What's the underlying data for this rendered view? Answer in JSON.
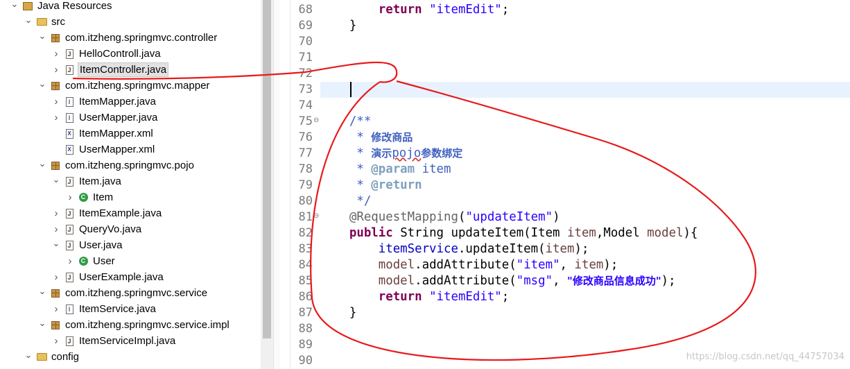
{
  "explorer": {
    "items": [
      {
        "label": "Java Resources",
        "twisty": "expanded",
        "icon": "library-folder-icon"
      },
      {
        "label": "src",
        "twisty": "expanded",
        "icon": "source-folder-icon"
      },
      {
        "label": "com.itzheng.springmvc.controller",
        "twisty": "expanded",
        "icon": "package-icon"
      },
      {
        "label": "HelloControll.java",
        "twisty": "collapsed",
        "icon": "java-file-icon"
      },
      {
        "label": "ItemController.java",
        "twisty": "collapsed",
        "icon": "java-file-icon",
        "selected": true
      },
      {
        "label": "com.itzheng.springmvc.mapper",
        "twisty": "expanded",
        "icon": "package-icon"
      },
      {
        "label": "ItemMapper.java",
        "twisty": "collapsed",
        "icon": "java-interface-icon"
      },
      {
        "label": "UserMapper.java",
        "twisty": "collapsed",
        "icon": "java-interface-icon"
      },
      {
        "label": "ItemMapper.xml",
        "twisty": "none",
        "icon": "xml-file-icon"
      },
      {
        "label": "UserMapper.xml",
        "twisty": "none",
        "icon": "xml-file-icon"
      },
      {
        "label": "com.itzheng.springmvc.pojo",
        "twisty": "expanded",
        "icon": "package-icon"
      },
      {
        "label": "Item.java",
        "twisty": "expanded",
        "icon": "java-file-icon"
      },
      {
        "label": "Item",
        "twisty": "collapsed",
        "icon": "class-icon"
      },
      {
        "label": "ItemExample.java",
        "twisty": "collapsed",
        "icon": "java-file-icon"
      },
      {
        "label": "QueryVo.java",
        "twisty": "collapsed",
        "icon": "java-file-icon"
      },
      {
        "label": "User.java",
        "twisty": "expanded",
        "icon": "java-file-icon"
      },
      {
        "label": "User",
        "twisty": "collapsed",
        "icon": "class-icon"
      },
      {
        "label": "UserExample.java",
        "twisty": "collapsed",
        "icon": "java-file-icon"
      },
      {
        "label": "com.itzheng.springmvc.service",
        "twisty": "expanded",
        "icon": "package-icon"
      },
      {
        "label": "ItemService.java",
        "twisty": "collapsed",
        "icon": "java-interface-icon"
      },
      {
        "label": "com.itzheng.springmvc.service.impl",
        "twisty": "expanded",
        "icon": "package-icon"
      },
      {
        "label": "ItemServiceImpl.java",
        "twisty": "collapsed",
        "icon": "java-file-icon"
      },
      {
        "label": "config",
        "twisty": "expanded",
        "icon": "source-folder-icon"
      }
    ]
  },
  "editor": {
    "current_line": 73,
    "lines": [
      {
        "n": "68",
        "tokens": [
          {
            "t": "        "
          },
          {
            "t": "return",
            "c": "kw"
          },
          {
            "t": " "
          },
          {
            "t": "\"itemEdit\"",
            "c": "str"
          },
          {
            "t": ";"
          }
        ]
      },
      {
        "n": "69",
        "tokens": [
          {
            "t": "    }"
          }
        ]
      },
      {
        "n": "70",
        "tokens": []
      },
      {
        "n": "71",
        "tokens": []
      },
      {
        "n": "72",
        "tokens": []
      },
      {
        "n": "73",
        "tokens": []
      },
      {
        "n": "74",
        "tokens": []
      },
      {
        "n": "75",
        "fold": "⊖",
        "tokens": [
          {
            "t": "    /**",
            "c": "cmt"
          }
        ]
      },
      {
        "n": "76",
        "tokens": [
          {
            "t": "     * ",
            "c": "cmt"
          },
          {
            "t": "修改商品",
            "c": "cmt cjk"
          }
        ]
      },
      {
        "n": "77",
        "tokens": [
          {
            "t": "     * ",
            "c": "cmt"
          },
          {
            "t": "演示",
            "c": "cmt cjk"
          },
          {
            "t": "pojo",
            "c": "cmt err"
          },
          {
            "t": "参数绑定",
            "c": "cmt cjk"
          }
        ]
      },
      {
        "n": "78",
        "tokens": [
          {
            "t": "     * ",
            "c": "cmt"
          },
          {
            "t": "@param",
            "c": "tag"
          },
          {
            "t": " item",
            "c": "cmt"
          }
        ]
      },
      {
        "n": "79",
        "tokens": [
          {
            "t": "     * ",
            "c": "cmt"
          },
          {
            "t": "@return",
            "c": "tag"
          }
        ]
      },
      {
        "n": "80",
        "tokens": [
          {
            "t": "     */",
            "c": "cmt"
          }
        ]
      },
      {
        "n": "81",
        "fold": "⊖",
        "tokens": [
          {
            "t": "    "
          },
          {
            "t": "@RequestMapping",
            "c": "ann"
          },
          {
            "t": "("
          },
          {
            "t": "\"updateItem\"",
            "c": "str"
          },
          {
            "t": ")"
          }
        ]
      },
      {
        "n": "82",
        "tokens": [
          {
            "t": "    "
          },
          {
            "t": "public",
            "c": "kw"
          },
          {
            "t": " String updateItem(Item "
          },
          {
            "t": "item",
            "c": "var"
          },
          {
            "t": ",Model "
          },
          {
            "t": "model",
            "c": "var"
          },
          {
            "t": "){"
          }
        ]
      },
      {
        "n": "83",
        "tokens": [
          {
            "t": "        "
          },
          {
            "t": "itemService",
            "c": "fld"
          },
          {
            "t": ".updateItem("
          },
          {
            "t": "item",
            "c": "var"
          },
          {
            "t": ");"
          }
        ]
      },
      {
        "n": "84",
        "tokens": [
          {
            "t": "        "
          },
          {
            "t": "model",
            "c": "var"
          },
          {
            "t": ".addAttribute("
          },
          {
            "t": "\"item\"",
            "c": "str"
          },
          {
            "t": ", "
          },
          {
            "t": "item",
            "c": "var"
          },
          {
            "t": ");"
          }
        ]
      },
      {
        "n": "85",
        "tokens": [
          {
            "t": "        "
          },
          {
            "t": "model",
            "c": "var"
          },
          {
            "t": ".addAttribute("
          },
          {
            "t": "\"msg\"",
            "c": "str"
          },
          {
            "t": ", "
          },
          {
            "t": "\"修改商品信息成功\"",
            "c": "str cjk"
          },
          {
            "t": ");"
          }
        ]
      },
      {
        "n": "86",
        "tokens": [
          {
            "t": "        "
          },
          {
            "t": "return",
            "c": "kw"
          },
          {
            "t": " "
          },
          {
            "t": "\"itemEdit\"",
            "c": "str"
          },
          {
            "t": ";"
          }
        ]
      },
      {
        "n": "87",
        "tokens": [
          {
            "t": "    }"
          }
        ]
      },
      {
        "n": "88",
        "tokens": []
      },
      {
        "n": "89",
        "tokens": []
      },
      {
        "n": "90",
        "tokens": []
      }
    ]
  },
  "annotation": {
    "color": "#e8191b"
  },
  "watermark": "https://blog.csdn.net/qq_44757034"
}
